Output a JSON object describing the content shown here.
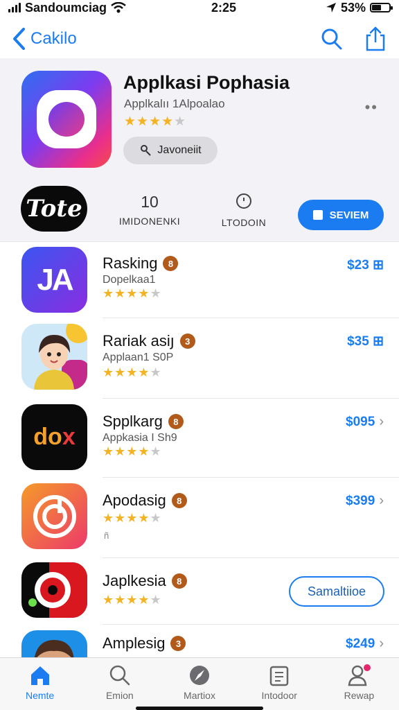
{
  "status": {
    "carrier": "Sandoumciag",
    "time": "2:25",
    "battery": "53%"
  },
  "nav": {
    "back_label": "Cakilo"
  },
  "featured": {
    "title": "Applkasi Pophasia",
    "subtitle": "Applkalıı 1Alpoalao",
    "rating": 4.5,
    "stars": "★★★★★",
    "get_label": "Javoneiit"
  },
  "meta": {
    "dev_logo_text": "Tote",
    "col1_value": "10",
    "col1_label": "IMIDONENKI",
    "col2_label": "LTODOIN",
    "review_label": "SEVIEM"
  },
  "apps": [
    {
      "name": "Rasking",
      "rank": "8",
      "sub": "Dopelkaa1",
      "stars": "★★★★★",
      "price": "$23 ⊞",
      "icon_text": "JA"
    },
    {
      "name": "Rariak asiյ",
      "rank": "3",
      "sub": "Applaan1 S0P",
      "stars": "★★★★★",
      "price": "$35 ⊞",
      "icon_text": ""
    },
    {
      "name": "Spplkarg",
      "rank": "8",
      "sub": "Appkasia I Sh9",
      "stars": "★★★★★",
      "price": "$095",
      "icon_text": "dox"
    },
    {
      "name": "Apodasig",
      "rank": "8",
      "sub": "",
      "stars": "★★★★★",
      "price": "$399",
      "extra": "ñ",
      "icon_text": ""
    },
    {
      "name": "Japlkesia",
      "rank": "8",
      "sub": "",
      "stars": "★★★★★",
      "button": "Samaltiioe",
      "icon_text": ""
    },
    {
      "name": "Amplesig",
      "rank": "3",
      "sub": "",
      "stars": "",
      "price": "$249",
      "icon_text": ""
    }
  ],
  "tabs": [
    {
      "label": "Nemte",
      "icon": "home-icon",
      "active": true
    },
    {
      "label": "Emion",
      "icon": "search-icon",
      "active": false
    },
    {
      "label": "Martiox",
      "icon": "compass-icon",
      "active": false
    },
    {
      "label": "Intodoor",
      "icon": "clipboard-icon",
      "active": false
    },
    {
      "label": "Rewap",
      "icon": "person-icon",
      "active": false
    }
  ],
  "colors": {
    "accent": "#1a7cf0",
    "star": "#f4b324",
    "badge": "#b25a1a",
    "notification_dot": "#e6266d"
  }
}
